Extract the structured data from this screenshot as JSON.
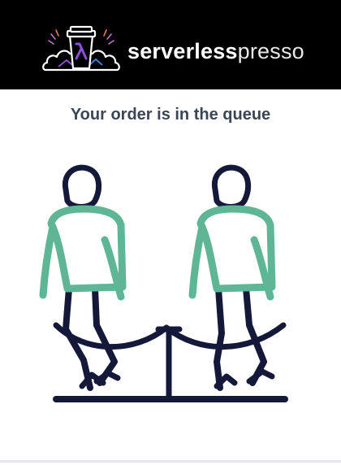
{
  "header": {
    "brand_bold": "serverless",
    "brand_light": "presso",
    "logo_icon": "coffee-cup-cloud-logo"
  },
  "main": {
    "status_title": "Your order is in the queue",
    "illustration_icon": "people-waiting-in-queue-illustration"
  },
  "colors": {
    "header_bg": "#000000",
    "title_text": "#3a4657",
    "figure_outline": "#14193a",
    "shirt_green": "#5fb697",
    "logo_purple": "#8a4fd6"
  }
}
